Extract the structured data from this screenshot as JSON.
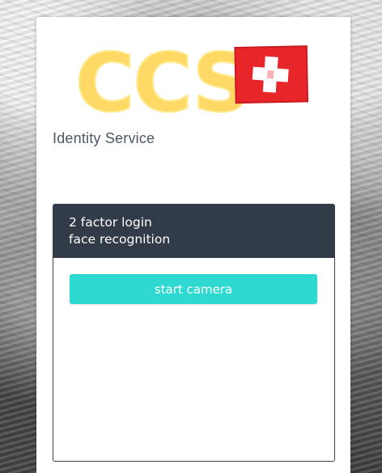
{
  "logo": {
    "text": "CCS",
    "flag": "swiss-flag-icon",
    "text_color": "#ffd966",
    "flag_color": "#e8262a"
  },
  "page": {
    "service_title": "Identity Service"
  },
  "card": {
    "header_line1": "2 factor login",
    "header_line2": "face recognition",
    "start_button_label": "start camera"
  },
  "colors": {
    "header_bg": "#323b48",
    "button_bg": "#2ed9d1",
    "title_text": "#4c5666"
  }
}
